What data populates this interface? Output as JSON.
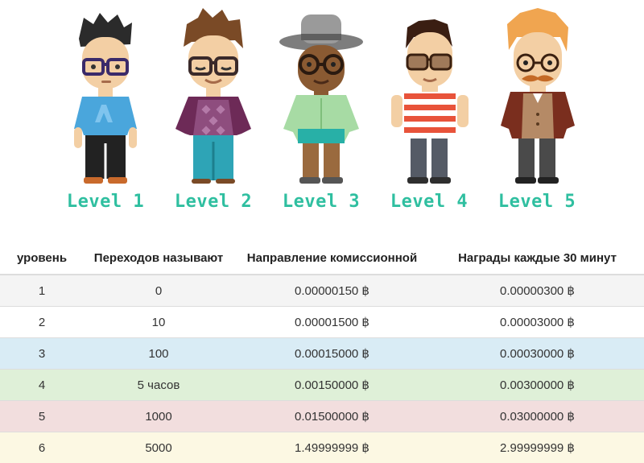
{
  "levels": [
    {
      "label": "Level 1"
    },
    {
      "label": "Level 2"
    },
    {
      "label": "Level 3"
    },
    {
      "label": "Level 4"
    },
    {
      "label": "Level 5"
    }
  ],
  "table": {
    "headers": [
      "уровень",
      "Переходов называют",
      "Направление комиссионной",
      "Награды каждые 30 минут"
    ],
    "rows": [
      [
        "1",
        "0",
        "0.00000150 ฿",
        "0.00000300 ฿"
      ],
      [
        "2",
        "10",
        "0.00001500 ฿",
        "0.00003000 ฿"
      ],
      [
        "3",
        "100",
        "0.00015000 ฿",
        "0.00030000 ฿"
      ],
      [
        "4",
        "5 часов",
        "0.00150000 ฿",
        "0.00300000 ฿"
      ],
      [
        "5",
        "1000",
        "0.01500000 ฿",
        "0.03000000 ฿"
      ],
      [
        "6",
        "5000",
        "1.49999999 ฿",
        "2.99999999 ฿"
      ]
    ]
  },
  "colors": {
    "level_label": "#2fbfa0",
    "row_3": "#d9ecf5",
    "row_4": "#dff0d8",
    "row_5": "#f2dede",
    "row_6": "#fcf8e3"
  }
}
